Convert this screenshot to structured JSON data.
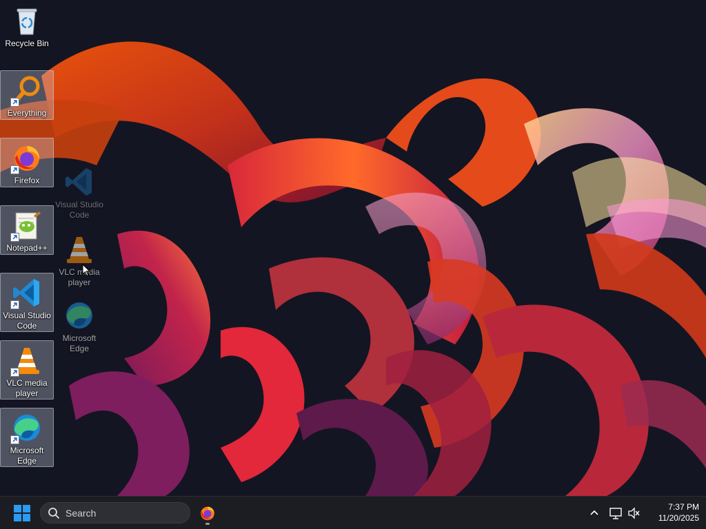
{
  "desktop": {
    "icons": [
      {
        "label": "Recycle Bin",
        "icon": "recycle-bin-icon",
        "shortcut": false
      },
      {
        "label": "Everything",
        "icon": "everything-search-icon",
        "shortcut": true
      },
      {
        "label": "Firefox",
        "icon": "firefox-icon",
        "shortcut": true
      },
      {
        "label": "Notepad++",
        "icon": "notepad-plus-plus-icon",
        "shortcut": true
      },
      {
        "label": "Visual Studio Code",
        "icon": "vscode-icon",
        "shortcut": true
      },
      {
        "label": "VLC media player",
        "icon": "vlc-icon",
        "shortcut": true
      },
      {
        "label": "Microsoft Edge",
        "icon": "edge-icon",
        "shortcut": true
      }
    ],
    "ghost_icons": [
      {
        "label": "Visual Studio Code",
        "icon": "vscode-icon"
      },
      {
        "label": "VLC media player",
        "icon": "vlc-icon"
      },
      {
        "label": "Microsoft Edge",
        "icon": "edge-icon"
      }
    ]
  },
  "taskbar": {
    "start_icon": "windows-logo-icon",
    "search": {
      "placeholder": "Search",
      "icon": "search-icon"
    },
    "pinned": [
      {
        "name": "Firefox",
        "icon": "firefox-icon",
        "running": true
      }
    ],
    "tray": {
      "chevron_icon": "chevron-up-icon",
      "network_icon": "network-icon",
      "volume_icon": "volume-muted-icon"
    },
    "clock": {
      "time": "7:37 PM",
      "date": "11/20/2025"
    }
  },
  "colors": {
    "taskbar_bg": "#1c1d22",
    "desktop_bg": "#121320",
    "selection": "#cdd7e6",
    "windows_blue": "#2b9af3"
  }
}
